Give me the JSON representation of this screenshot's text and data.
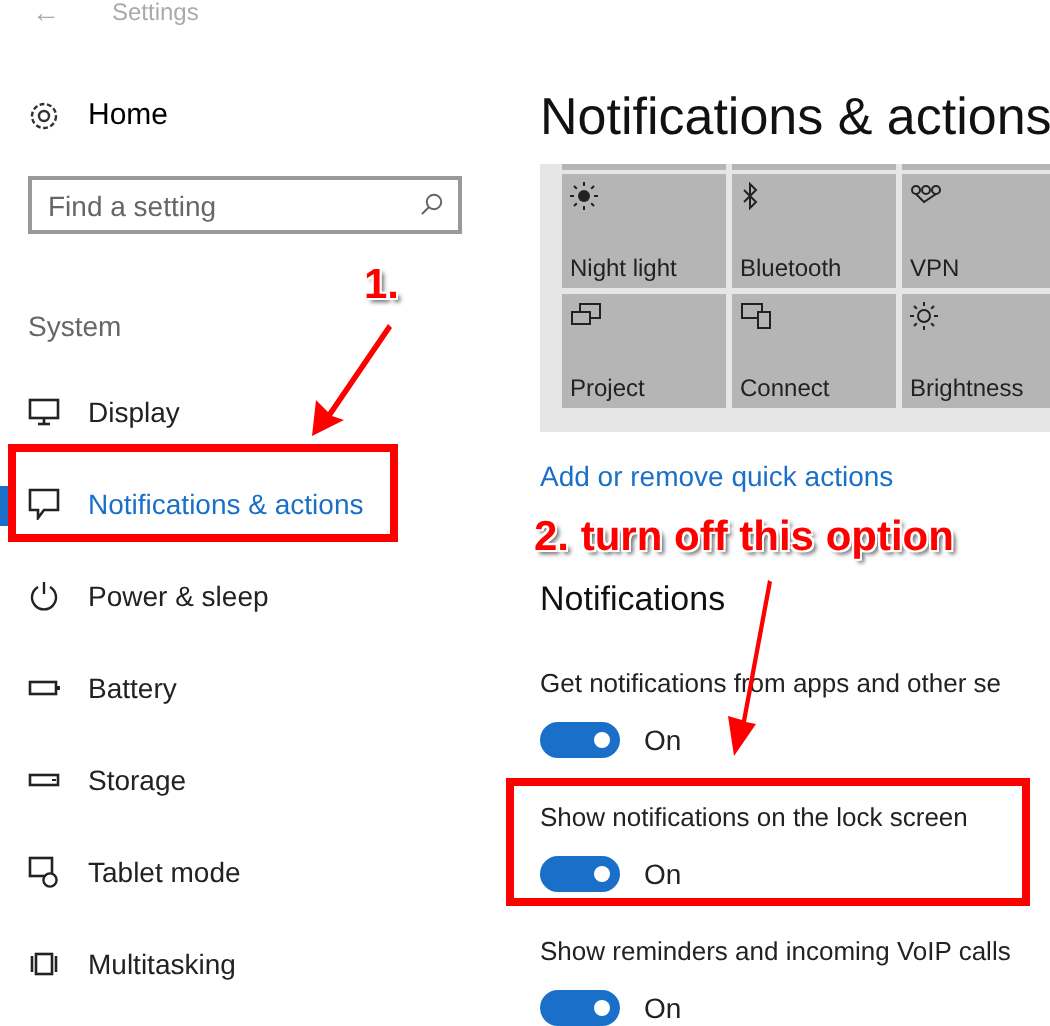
{
  "window": {
    "title": "Settings",
    "back": "←"
  },
  "sidebar": {
    "home": "Home",
    "search": {
      "placeholder": "Find a setting"
    },
    "section": "System",
    "items": [
      {
        "label": "Display",
        "selected": false
      },
      {
        "label": "Notifications & actions",
        "selected": true
      },
      {
        "label": "Power & sleep",
        "selected": false
      },
      {
        "label": "Battery",
        "selected": false
      },
      {
        "label": "Storage",
        "selected": false
      },
      {
        "label": "Tablet mode",
        "selected": false
      },
      {
        "label": "Multitasking",
        "selected": false
      }
    ]
  },
  "main": {
    "title": "Notifications & actions",
    "quick_actions": [
      {
        "label": "Night light"
      },
      {
        "label": "Bluetooth"
      },
      {
        "label": "VPN"
      },
      {
        "label": "Project"
      },
      {
        "label": "Connect"
      },
      {
        "label": "Brightness"
      }
    ],
    "quick_actions_link": "Add or remove quick actions",
    "section": "Notifications",
    "settings": [
      {
        "label": "Get notifications from apps and other se",
        "on": true,
        "state": "On"
      },
      {
        "label": "Show notifications on the lock screen",
        "on": true,
        "state": "On"
      },
      {
        "label": "Show reminders and incoming VoIP calls",
        "on": true,
        "state": "On"
      }
    ]
  },
  "annotations": [
    {
      "text": "1."
    },
    {
      "text": "2. turn off this option"
    }
  ]
}
